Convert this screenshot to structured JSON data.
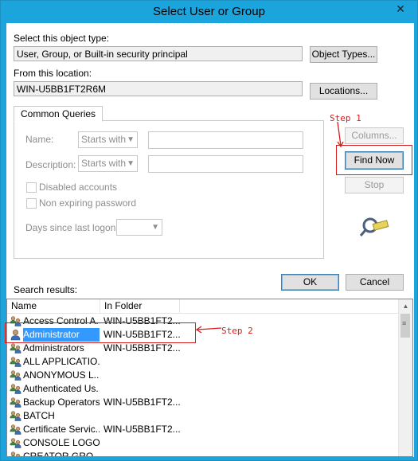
{
  "window": {
    "title": "Select User or Group",
    "close_glyph": "✕"
  },
  "object_type": {
    "label": "Select this object type:",
    "value": "User, Group, or Built-in security principal",
    "button": "Object Types..."
  },
  "location": {
    "label": "From this location:",
    "value": "WIN-U5BB1FT2R6M",
    "button": "Locations..."
  },
  "queries": {
    "tab": "Common Queries",
    "name_label": "Name:",
    "name_mode": "Starts with",
    "description_label": "Description:",
    "description_mode": "Starts with",
    "disabled_accounts": "Disabled accounts",
    "non_expiring_password": "Non expiring password",
    "days_since_logon": "Days since last logon:"
  },
  "buttons": {
    "columns": "Columns...",
    "find_now": "Find Now",
    "stop": "Stop",
    "ok": "OK",
    "cancel": "Cancel"
  },
  "annotations": {
    "step1": "Step 1",
    "step2": "Step 2",
    "color": "#d41c1c"
  },
  "results": {
    "label": "Search results:",
    "columns": [
      "Name",
      "In Folder"
    ],
    "rows": [
      {
        "name": "Access Control A...",
        "folder": "WIN-U5BB1FT2...",
        "icon": "group-icon"
      },
      {
        "name": "Administrator",
        "folder": "WIN-U5BB1FT2...",
        "icon": "user-icon",
        "selected": true
      },
      {
        "name": "Administrators",
        "folder": "WIN-U5BB1FT2...",
        "icon": "group-icon"
      },
      {
        "name": "ALL APPLICATIO...",
        "folder": "",
        "icon": "group-icon"
      },
      {
        "name": "ANONYMOUS L...",
        "folder": "",
        "icon": "group-icon"
      },
      {
        "name": "Authenticated Us...",
        "folder": "",
        "icon": "group-icon"
      },
      {
        "name": "Backup Operators",
        "folder": "WIN-U5BB1FT2...",
        "icon": "group-icon"
      },
      {
        "name": "BATCH",
        "folder": "",
        "icon": "group-icon"
      },
      {
        "name": "Certificate Servic...",
        "folder": "WIN-U5BB1FT2...",
        "icon": "group-icon"
      },
      {
        "name": "CONSOLE LOGON",
        "folder": "",
        "icon": "group-icon"
      },
      {
        "name": "CREATOR GRO...",
        "folder": "",
        "icon": "group-icon"
      }
    ]
  },
  "colors": {
    "titlebar": "#1ba5dc",
    "selection": "#3399ff"
  }
}
